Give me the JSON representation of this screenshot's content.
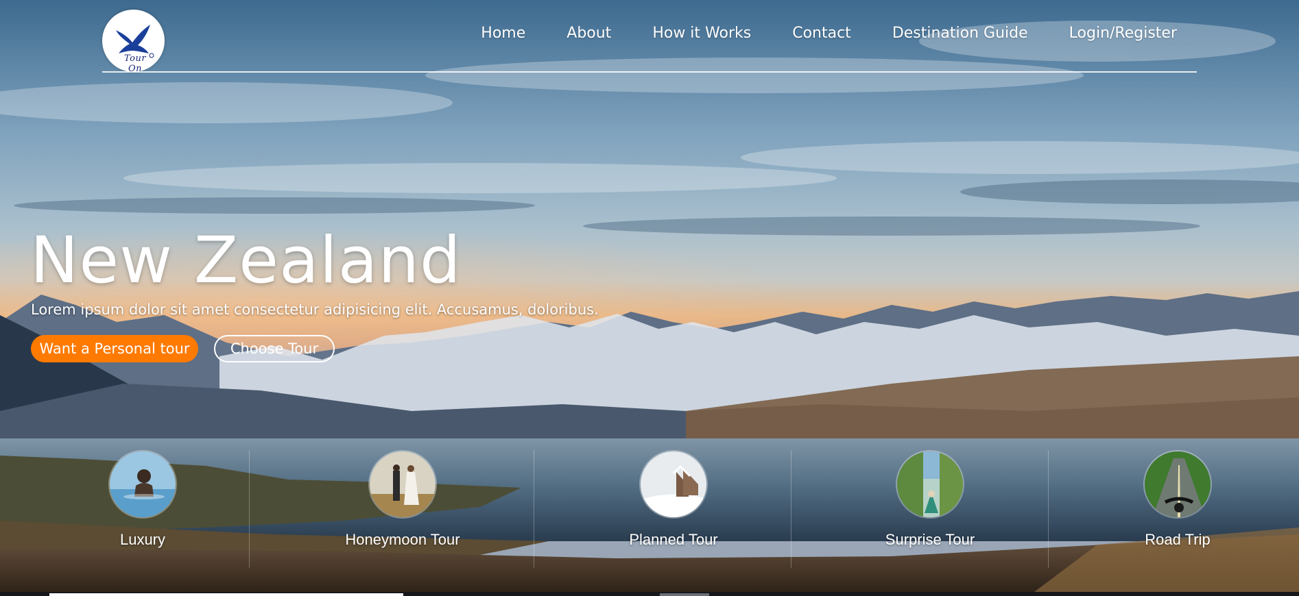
{
  "logo": {
    "text": "Tour On"
  },
  "nav": {
    "items": [
      "Home",
      "About",
      "How it Works",
      "Contact",
      "Destination Guide",
      "Login/Register"
    ]
  },
  "hero": {
    "title": "New Zealand",
    "subtitle": "Lorem ipsum dolor sit amet consectetur adipisicing elit. Accusamus, doloribus.",
    "primary_button": "Want a Personal tour",
    "secondary_button": "Choose Tour"
  },
  "tours": [
    {
      "label": "Luxury",
      "icon": "luxury-pool-thumbnail"
    },
    {
      "label": "Honeymoon Tour",
      "icon": "couple-thumbnail"
    },
    {
      "label": "Planned Tour",
      "icon": "snowy-cabin-thumbnail"
    },
    {
      "label": "Surprise Tour",
      "icon": "kayak-thumbnail"
    },
    {
      "label": "Road Trip",
      "icon": "motorcycle-road-thumbnail"
    }
  ],
  "colors": {
    "accent": "#ff7a00",
    "text": "#ffffff",
    "logo_bird": "#1a2a7a"
  }
}
